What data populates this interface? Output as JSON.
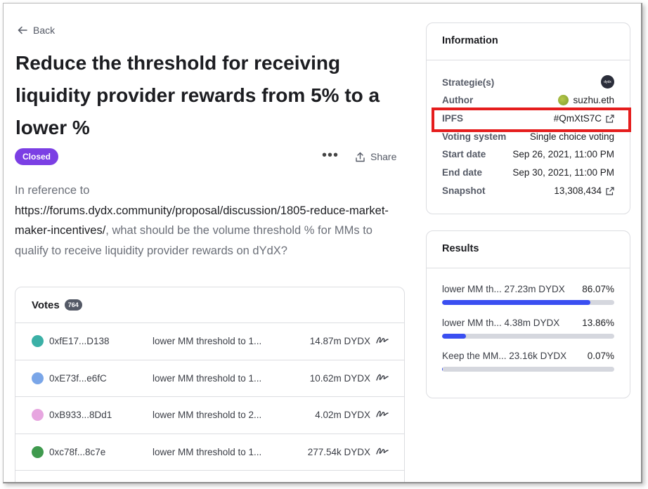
{
  "nav": {
    "back_label": "Back"
  },
  "proposal": {
    "title": "Reduce the threshold for receiving liquidity provider rewards from 5% to a lower %",
    "status": "Closed",
    "more_label": "•••",
    "share_label": "Share",
    "body_prefix": "In reference to",
    "body_link": "https://forums.dydx.community/proposal/discussion/1805-reduce-market-maker-incentives/",
    "body_suffix": ", what should be the volume threshold % for MMs to qualify to receive liquidity provider rewards on dYdX?"
  },
  "votes": {
    "heading": "Votes",
    "count": "764",
    "rows": [
      {
        "address": "0xfE17...D138",
        "choice": "lower MM threshold to 1...",
        "amount": "14.87m DYDX",
        "avatar_color": "#3bb0a6"
      },
      {
        "address": "0xE73f...e6fC",
        "choice": "lower MM threshold to 1...",
        "amount": "10.62m DYDX",
        "avatar_color": "#7aa6e8"
      },
      {
        "address": "0xB933...8Dd1",
        "choice": "lower MM threshold to 2...",
        "amount": "4.02m DYDX",
        "avatar_color": "#e7a6e0"
      },
      {
        "address": "0xc78f...8c7e",
        "choice": "lower MM threshold to 1...",
        "amount": "277.54k DYDX",
        "avatar_color": "#3f9a4e"
      }
    ]
  },
  "information": {
    "heading": "Information",
    "strategies_label": "Strategie(s)",
    "strategy_icon_text": "dydx",
    "author_label": "Author",
    "author_value": "suzhu.eth",
    "ipfs_label": "IPFS",
    "ipfs_value": "#QmXtS7C",
    "voting_system_label": "Voting system",
    "voting_system_value": "Single choice voting",
    "start_label": "Start date",
    "start_value": "Sep 26, 2021, 11:00 PM",
    "end_label": "End date",
    "end_value": "Sep 30, 2021, 11:00 PM",
    "snapshot_label": "Snapshot",
    "snapshot_value": "13,308,434"
  },
  "results": {
    "heading": "Results",
    "items": [
      {
        "label": "lower MM th... 27.23m DYDX",
        "percent": "86.07%",
        "fraction": 0.8607
      },
      {
        "label": "lower MM th... 4.38m DYDX",
        "percent": "13.86%",
        "fraction": 0.1386
      },
      {
        "label": "Keep the MM... 23.16k DYDX",
        "percent": "0.07%",
        "fraction": 0.0007
      }
    ]
  },
  "colors": {
    "status_closed": "#7b3fe4",
    "result_bar": "#3a4ff1",
    "highlight": "#e51d1d"
  }
}
